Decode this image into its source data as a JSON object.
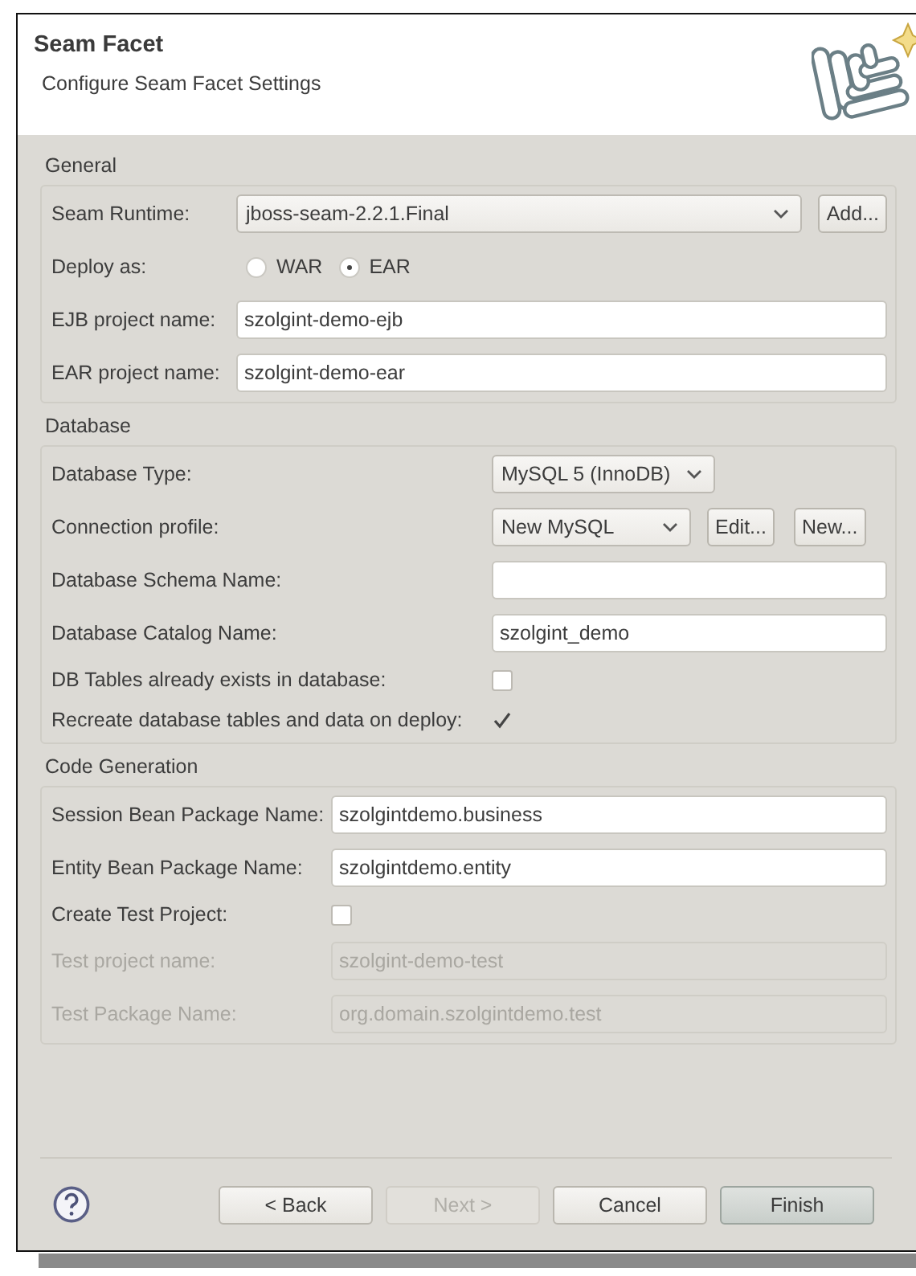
{
  "header": {
    "title": "Seam Facet",
    "subtitle": "Configure Seam Facet Settings"
  },
  "sections": [
    {
      "title": "General",
      "rows": [
        {
          "kind": "combo",
          "label": "Seam Runtime:",
          "value": "jboss-seam-2.2.1.Final",
          "buttons": [
            "Add..."
          ],
          "disabled": false
        },
        {
          "kind": "radio",
          "label": "Deploy as:",
          "options": [
            {
              "label": "WAR",
              "selected": false
            },
            {
              "label": "EAR",
              "selected": true
            }
          ],
          "disabled": false
        },
        {
          "kind": "text",
          "label": "EJB project name:",
          "value": "szolgint-demo-ejb",
          "disabled": false
        },
        {
          "kind": "text",
          "label": "EAR project name:",
          "value": "szolgint-demo-ear",
          "disabled": false
        }
      ]
    },
    {
      "title": "Database",
      "rows": [
        {
          "kind": "combo",
          "label": "Database Type:",
          "value": "MySQL 5 (InnoDB)",
          "disabled": false
        },
        {
          "kind": "combo",
          "label": "Connection profile:",
          "value": "New MySQL",
          "buttons": [
            "Edit...",
            "New..."
          ],
          "disabled": false
        },
        {
          "kind": "text",
          "label": "Database Schema Name:",
          "disabled": false
        },
        {
          "kind": "text",
          "label": "Database Catalog Name:",
          "value": "szolgint_demo",
          "disabled": false
        },
        {
          "kind": "checkbox",
          "label": "DB Tables already exists in database:",
          "checked": false,
          "disabled": false
        },
        {
          "kind": "checkbox",
          "label": "Recreate database tables and data on deploy:",
          "checked": true,
          "disabled": false
        }
      ]
    },
    {
      "title": "Code Generation",
      "rows": [
        {
          "kind": "text",
          "label": "Session Bean Package Name:",
          "value": "szolgintdemo.business",
          "disabled": false
        },
        {
          "kind": "text",
          "label": "Entity Bean Package Name:",
          "value": "szolgintdemo.entity",
          "disabled": false
        },
        {
          "kind": "checkbox",
          "label": "Create Test Project:",
          "checked": false,
          "disabled": false
        },
        {
          "kind": "text",
          "label": "Test project name:",
          "value": "szolgint-demo-test",
          "disabled": true
        },
        {
          "kind": "text",
          "label": "Test Package Name:",
          "value": "org.domain.szolgintdemo.test",
          "disabled": true
        }
      ]
    }
  ],
  "buttons": [
    {
      "label": "< Back",
      "disabled": false,
      "focused": false
    },
    {
      "label": "Next >",
      "disabled": true,
      "focused": false
    },
    {
      "label": "Cancel",
      "disabled": false,
      "focused": false
    },
    {
      "label": "Finish",
      "disabled": false,
      "focused": true
    }
  ]
}
